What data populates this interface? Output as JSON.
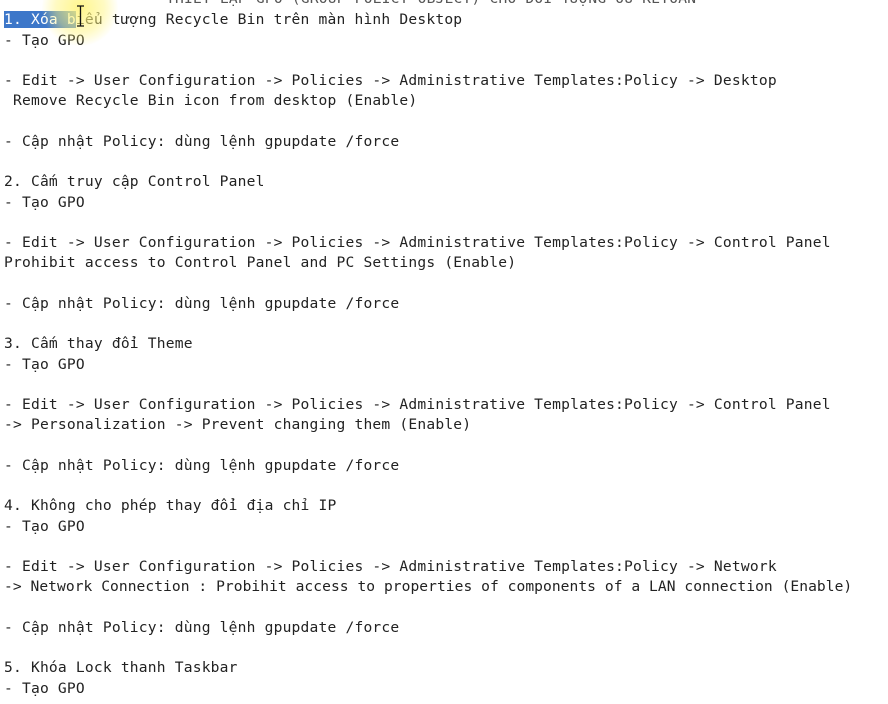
{
  "document": {
    "header_partial": "THIẾT LẬP GPO (GROUP POLICY OBJECT) CHO ĐỐI TƯỢNG OU KETOAN",
    "selection": "1. Xóa b",
    "lines": [
      "iểu tượng Recycle Bin trên màn hình Desktop",
      "- Tạo GPO",
      "",
      "- Edit -> User Configuration -> Policies -> Administrative Templates:Policy -> Desktop",
      " Remove Recycle Bin icon from desktop (Enable)",
      "",
      "- Cập nhật Policy: dùng lệnh gpupdate /force",
      "",
      "2. Cấm truy cập Control Panel",
      "- Tạo GPO",
      "",
      "- Edit -> User Configuration -> Policies -> Administrative Templates:Policy -> Control Panel",
      "Prohibit access to Control Panel and PC Settings (Enable)",
      "",
      "- Cập nhật Policy: dùng lệnh gpupdate /force",
      "",
      "3. Cấm thay đổi Theme",
      "- Tạo GPO",
      "",
      "- Edit -> User Configuration -> Policies -> Administrative Templates:Policy -> Control Panel",
      "-> Personalization -> Prevent changing them (Enable)",
      "",
      "- Cập nhật Policy: dùng lệnh gpupdate /force",
      "",
      "4. Không cho phép thay đổi địa chỉ IP",
      "- Tạo GPO",
      "",
      "- Edit -> User Configuration -> Policies -> Administrative Templates:Policy -> Network",
      "-> Network Connection : Probihit access to properties of components of a LAN connection (Enable)",
      "",
      "- Cập nhật Policy: dùng lệnh gpupdate /force",
      "",
      "5. Khóa Lock thanh Taskbar",
      "- Tạo GPO"
    ]
  },
  "colors": {
    "background": "#ffffff",
    "text": "#222222",
    "selection": "#3d77c9",
    "cursor_highlight": "#fff478"
  }
}
